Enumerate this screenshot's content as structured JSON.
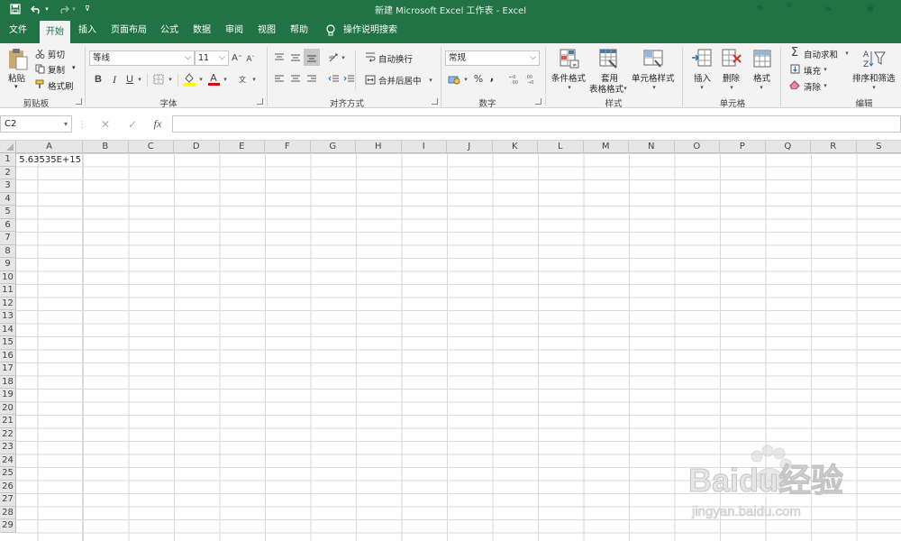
{
  "window": {
    "title": "新建 Microsoft Excel 工作表  -  Excel"
  },
  "quick_access": {
    "save_icon": "save-icon",
    "undo_icon": "undo-icon",
    "redo_icon": "redo-icon",
    "customize_icon": "customize-icon"
  },
  "tabs": [
    {
      "label": "文件"
    },
    {
      "label": "开始",
      "active": true
    },
    {
      "label": "插入"
    },
    {
      "label": "页面布局"
    },
    {
      "label": "公式"
    },
    {
      "label": "数据"
    },
    {
      "label": "审阅"
    },
    {
      "label": "视图"
    },
    {
      "label": "帮助"
    }
  ],
  "tell_me": "操作说明搜索",
  "ribbon": {
    "clipboard": {
      "label": "剪贴板",
      "paste": "粘贴",
      "cut": "剪切",
      "copy": "复制",
      "format_painter": "格式刷"
    },
    "font": {
      "label": "字体",
      "font_name": "等线",
      "font_size": "11",
      "bold": "B",
      "italic": "I",
      "underline": "U",
      "grow": "A",
      "shrink": "A",
      "font_color_letter": "A",
      "phonetic": "文"
    },
    "alignment": {
      "label": "对齐方式",
      "wrap_text": "自动换行",
      "merge_center": "合并后居中"
    },
    "number": {
      "label": "数字",
      "format": "常规",
      "percent": "%",
      "comma": ","
    },
    "styles": {
      "label": "样式",
      "conditional": "条件格式",
      "table_line1": "套用",
      "table_line2": "表格格式",
      "cell_styles": "单元格样式"
    },
    "cells": {
      "label": "单元格",
      "insert": "插入",
      "delete": "删除",
      "format": "格式"
    },
    "editing": {
      "label": "编辑",
      "autosum": "自动求和",
      "fill": "填充",
      "clear": "清除",
      "sort_filter": "排序和筛选",
      "sigma": "Σ"
    }
  },
  "formula_bar": {
    "name_box": "C2",
    "fx": "fx",
    "value": ""
  },
  "grid": {
    "columns": [
      "A",
      "B",
      "C",
      "D",
      "E",
      "F",
      "G",
      "H",
      "I",
      "J",
      "K",
      "L",
      "M",
      "N",
      "O",
      "P",
      "Q",
      "R",
      "S"
    ],
    "rows": [
      "1",
      "2",
      "3",
      "4",
      "5",
      "6",
      "7",
      "8",
      "9",
      "10",
      "11",
      "12",
      "13",
      "14",
      "15",
      "16",
      "17",
      "18",
      "19",
      "20",
      "21",
      "22",
      "23",
      "24",
      "25",
      "26",
      "27",
      "28",
      "29"
    ],
    "cell_A1": "5.63535E+15"
  },
  "watermark": {
    "brand": "Baidu经验",
    "url": "jingyan.baidu.com"
  },
  "colors": {
    "excel_green": "#217346",
    "ribbon_bg": "#f3f3f3",
    "gridline": "#dadada"
  }
}
